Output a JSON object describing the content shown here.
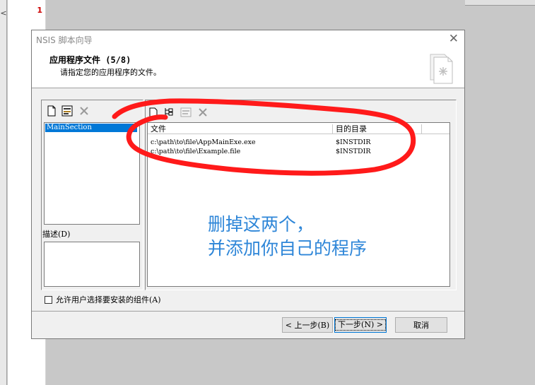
{
  "editor": {
    "line_number": "1",
    "gutter_glyph": "<"
  },
  "dialog": {
    "title": "NSIS 脚本向导",
    "close_glyph": "✕",
    "header": {
      "title": "应用程序文件 (5/8)",
      "subtitle": "请指定您的应用程序的文件。"
    },
    "sections": {
      "items": [
        "MainSection"
      ],
      "selected": "MainSection"
    },
    "description_label": "描述(D)",
    "files": {
      "columns": [
        "文件",
        "目的目录"
      ],
      "rows": [
        [
          "c:\\path\\to\\file\\AppMainExe.exe",
          "$INSTDIR"
        ],
        [
          "c:\\path\\to\\file\\Example.file",
          "$INSTDIR"
        ]
      ]
    },
    "allow_select_label": "允许用户选择要安装的组件(A)",
    "allow_select_checked": false,
    "buttons": {
      "back": "< 上一步(B)",
      "next": "下一步(N) >",
      "cancel": "取消"
    }
  },
  "annotation": {
    "line1": "删掉这两个，",
    "line2": "并添加你自己的程序",
    "color": "#2e86d8"
  },
  "scribble_color": "#ff1a1a"
}
